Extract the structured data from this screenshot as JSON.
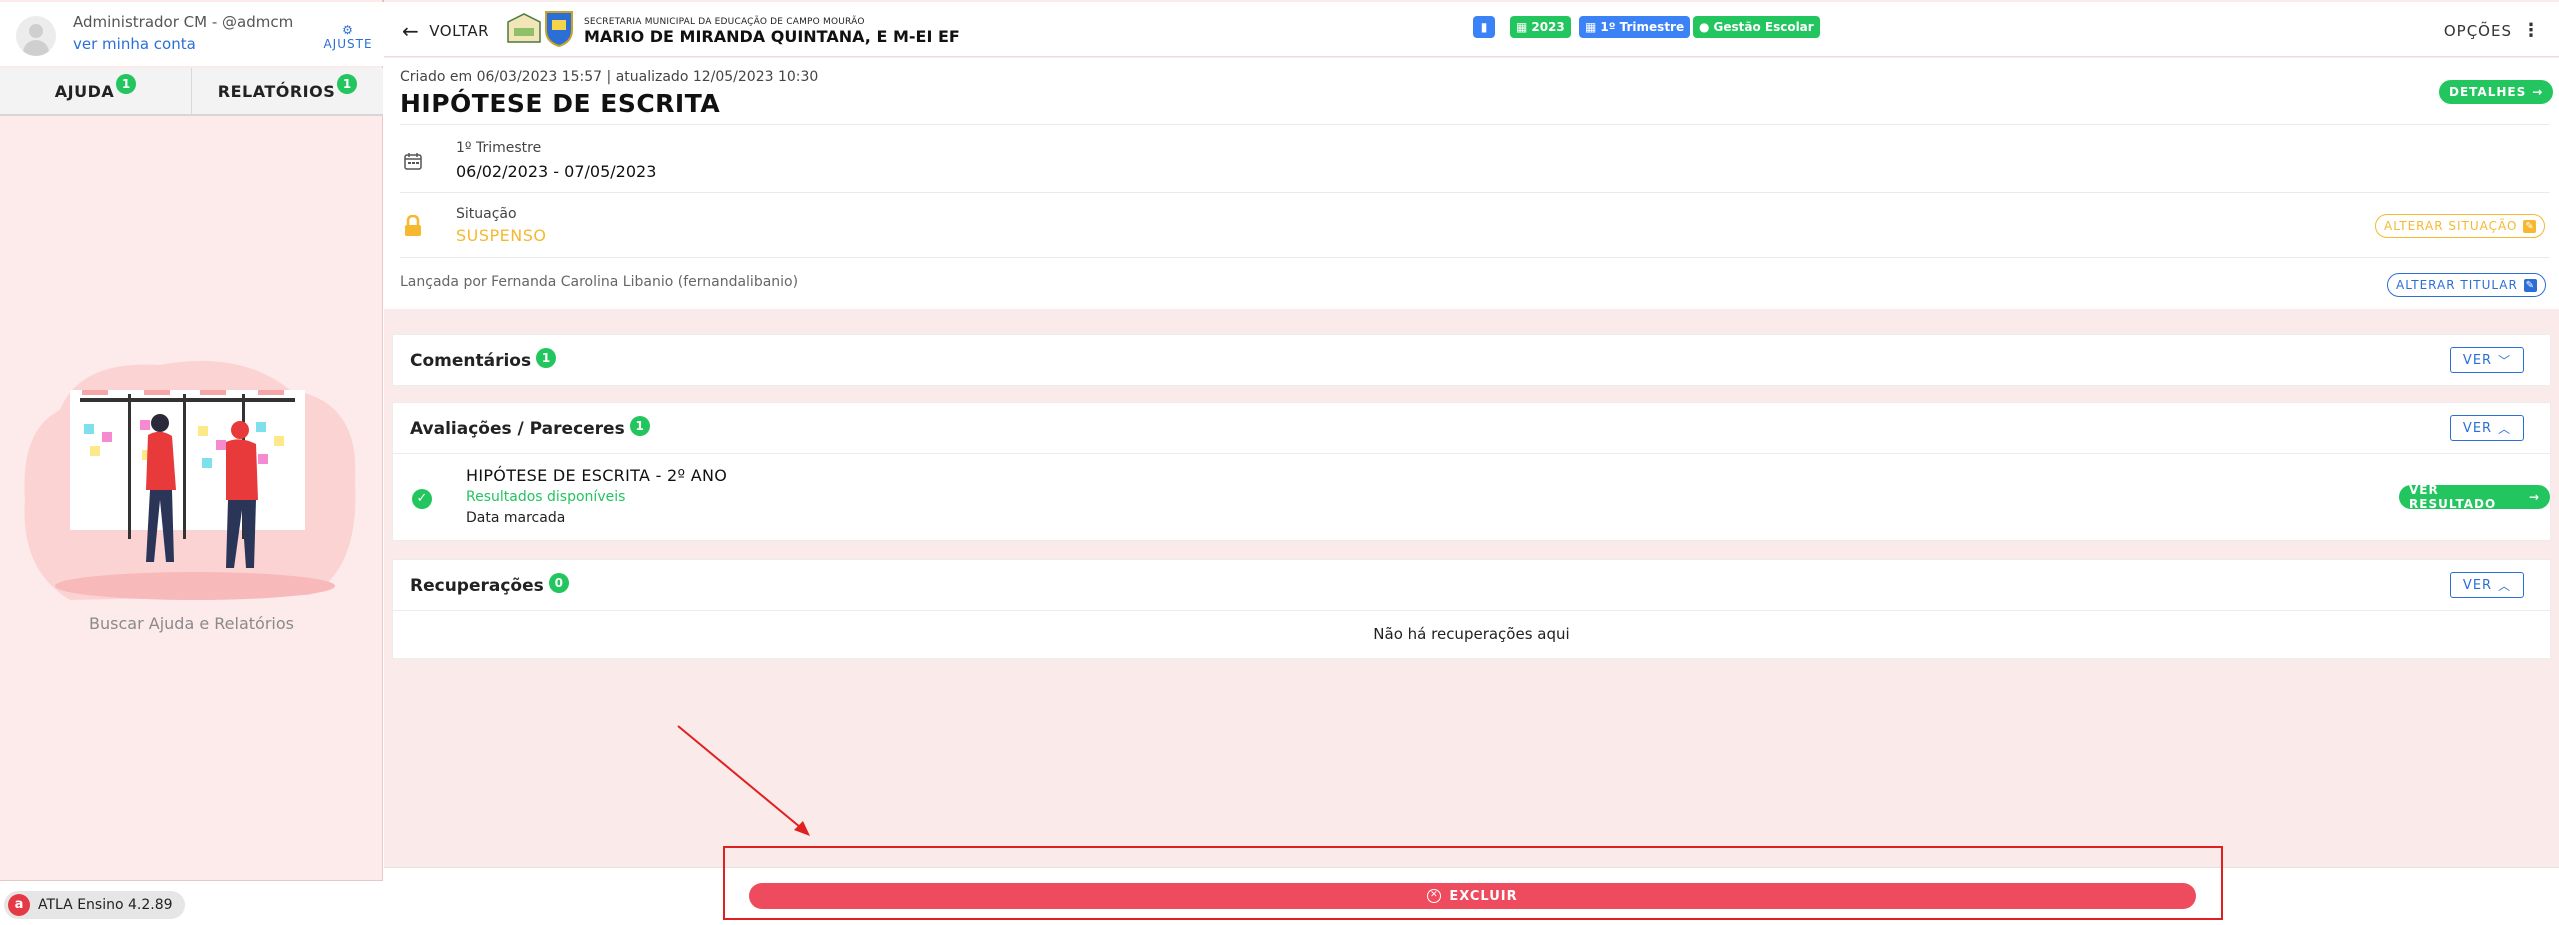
{
  "user": {
    "name": "Administrador CM - @admcm",
    "account_link": "ver minha conta",
    "adjust_label": "AJUSTE"
  },
  "sidebar": {
    "tabs": [
      {
        "label": "AJUDA",
        "count": "1"
      },
      {
        "label": "RELATÓRIOS",
        "count": "1"
      }
    ],
    "help_caption": "Buscar Ajuda e Relatórios",
    "version": "ATLA Ensino 4.2.89"
  },
  "header": {
    "back_label": "VOLTAR",
    "school_sub": "SECRETARIA MUNICIPAL DA EDUCAÇÃO DE CAMPO MOURÃO",
    "school_name": "MARIO DE MIRANDA QUINTANA, E M-EI EF",
    "chips": {
      "year": "2023",
      "term": "1º Trimestre",
      "module": "Gestão Escolar"
    },
    "options_label": "OPÇÕES"
  },
  "record": {
    "meta": "Criado em 06/03/2023 15:57 | atualizado 12/05/2023 10:30",
    "title": "HIPÓTESE DE ESCRITA",
    "details_label": "DETALHES",
    "period_label": "1º Trimestre",
    "period_value": "06/02/2023 - 07/05/2023",
    "situation_label": "Situação",
    "situation_value": "SUSPENSO",
    "change_situation_label": "ALTERAR SITUAÇÃO",
    "launched_by": "Lançada por Fernanda Carolina Libanio (fernandalibanio)",
    "change_owner_label": "ALTERAR TITULAR"
  },
  "sections": {
    "comments": {
      "title": "Comentários",
      "count": "1",
      "ver_label": "VER"
    },
    "evaluations": {
      "title": "Avaliações / Pareceres",
      "count": "1",
      "ver_label": "VER",
      "item": {
        "title": "HIPÓTESE DE ESCRITA - 2º ANO",
        "status": "Resultados disponíveis",
        "date": "Data marcada",
        "result_label": "VER RESULTADO"
      }
    },
    "recoveries": {
      "title": "Recuperações",
      "count": "0",
      "ver_label": "VER",
      "empty_text": "Não há recuperações aqui"
    }
  },
  "footer": {
    "delete_label": "EXCLUIR"
  },
  "colors": {
    "accent_green": "#22c55e",
    "accent_blue": "#3b82f6",
    "danger": "#ee4c5e",
    "warning": "#f5b82e",
    "annotation": "#e02020"
  }
}
